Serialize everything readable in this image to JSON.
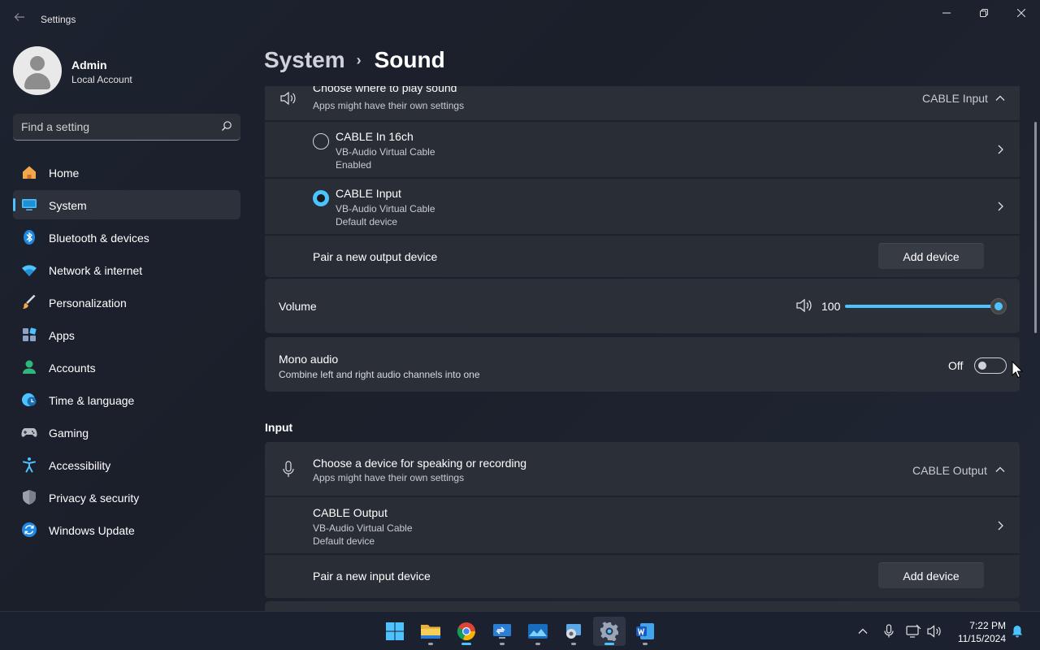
{
  "window": {
    "title": "Settings",
    "back_icon": "back-arrow-icon",
    "controls": [
      "minimize-icon",
      "restore-icon",
      "close-icon"
    ]
  },
  "profile": {
    "name": "Admin",
    "account_type": "Local Account"
  },
  "search": {
    "placeholder": "Find a setting",
    "icon": "search-icon"
  },
  "sidebar": {
    "active": "System",
    "items": [
      {
        "label": "Home",
        "icon": "home-icon"
      },
      {
        "label": "System",
        "icon": "monitor-icon"
      },
      {
        "label": "Bluetooth & devices",
        "icon": "bluetooth-icon"
      },
      {
        "label": "Network & internet",
        "icon": "wifi-icon"
      },
      {
        "label": "Personalization",
        "icon": "brush-icon"
      },
      {
        "label": "Apps",
        "icon": "apps-icon"
      },
      {
        "label": "Accounts",
        "icon": "person-icon"
      },
      {
        "label": "Time & language",
        "icon": "globe-clock-icon"
      },
      {
        "label": "Gaming",
        "icon": "gamepad-icon"
      },
      {
        "label": "Accessibility",
        "icon": "accessibility-icon"
      },
      {
        "label": "Privacy & security",
        "icon": "shield-icon"
      },
      {
        "label": "Windows Update",
        "icon": "update-icon"
      }
    ]
  },
  "breadcrumb": {
    "parent": "System",
    "separator": "›",
    "current": "Sound"
  },
  "output": {
    "header_title": "Choose where to play sound",
    "header_sub": "Apps might have their own settings",
    "selected": "CABLE Input",
    "devices": [
      {
        "name": "CABLE In 16ch",
        "driver": "VB-Audio Virtual Cable",
        "status": "Enabled",
        "selected": false
      },
      {
        "name": "CABLE Input",
        "driver": "VB-Audio Virtual Cable",
        "status": "Default device",
        "selected": true
      }
    ],
    "pair_label": "Pair a new output device",
    "pair_button": "Add device"
  },
  "volume": {
    "label": "Volume",
    "value": "100",
    "level_percent": 100
  },
  "mono": {
    "label": "Mono audio",
    "sub": "Combine left and right audio channels into one",
    "state": "Off"
  },
  "input": {
    "section_title": "Input",
    "header_title": "Choose a device for speaking or recording",
    "header_sub": "Apps might have their own settings",
    "selected": "CABLE Output",
    "devices": [
      {
        "name": "CABLE Output",
        "driver": "VB-Audio Virtual Cable",
        "status": "Default device"
      }
    ],
    "pair_label": "Pair a new input device",
    "pair_button": "Add device"
  },
  "taskbar": {
    "apps": [
      "windows-start-icon",
      "file-explorer-icon",
      "chrome-icon",
      "remote-desktop-icon",
      "photos-icon",
      "control-panel-icon",
      "settings-gear-icon",
      "word-icon"
    ],
    "active_app": "settings-gear-icon",
    "time": "7:22 PM",
    "date": "11/15/2024"
  },
  "colors": {
    "accent": "#4cc2ff",
    "background": "#1c2029",
    "card": "#2b2f38"
  }
}
